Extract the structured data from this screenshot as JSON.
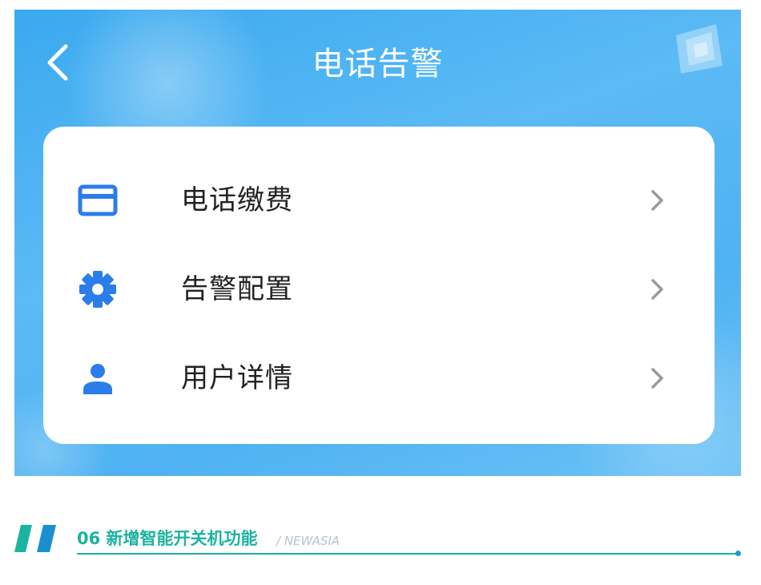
{
  "header": {
    "title": "电话告警",
    "back_icon": "chevron-left-icon"
  },
  "menu": {
    "items": [
      {
        "label": "电话缴费",
        "icon": "credit-card-icon"
      },
      {
        "label": "告警配置",
        "icon": "gear-icon"
      },
      {
        "label": "用户详情",
        "icon": "user-icon"
      }
    ],
    "accent_color": "#2b7de9"
  },
  "footer": {
    "section_title": "06 新增智能开关机功能",
    "subtitle": "/ NEWASIA",
    "accent_color": "#1cb3a0"
  }
}
